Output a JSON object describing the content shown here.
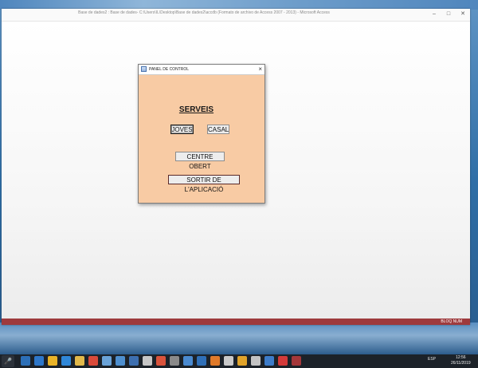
{
  "window": {
    "title": "Base de dades2 : Base de dades- C:\\Users\\IL\\Desktop\\Base de dades2\\accdb (Formato de archivo de Access 2007 - 2013) - Microsoft Access",
    "min_icon": "minimize-icon",
    "max_icon": "maximize-icon",
    "close_icon": "close-icon"
  },
  "form": {
    "title": "PANEL DE CONTROL",
    "close_label": "×",
    "heading": "SERVEIS",
    "buttons": {
      "joves": "JOVES",
      "casal": "CASAL",
      "centre": "CENTRE OBERT",
      "sortir": "SORTIR DE L'APLICACIÓ"
    }
  },
  "statusbar": {
    "text": "BLOQ NUM"
  },
  "taskbar": {
    "search_label": "🎤",
    "language": "ESP",
    "clock_time": "12:56",
    "clock_date": "26/11/2019",
    "apps": [
      {
        "name": "cortana-icon",
        "color": "#2c6fb7"
      },
      {
        "name": "mail-icon",
        "color": "#2e77c9"
      },
      {
        "name": "chrome-icon",
        "color": "#e8b227"
      },
      {
        "name": "edge-icon",
        "color": "#2f87d8"
      },
      {
        "name": "file-explorer-icon",
        "color": "#e1b84a"
      },
      {
        "name": "chrome-alt-icon",
        "color": "#d94a3a"
      },
      {
        "name": "app-icon-7",
        "color": "#6aa3d8"
      },
      {
        "name": "app-icon-8",
        "color": "#4e8fcf"
      },
      {
        "name": "app-icon-9",
        "color": "#3d6fb0"
      },
      {
        "name": "app-icon-10",
        "color": "#c6c6c6"
      },
      {
        "name": "app-icon-11",
        "color": "#d9533c"
      },
      {
        "name": "app-icon-12",
        "color": "#8a8a8a"
      },
      {
        "name": "app-icon-13",
        "color": "#4a8ad0"
      },
      {
        "name": "app-icon-14",
        "color": "#2f6fb7"
      },
      {
        "name": "app-icon-15",
        "color": "#e07a2a"
      },
      {
        "name": "app-icon-16",
        "color": "#c9c9c9"
      },
      {
        "name": "app-icon-17",
        "color": "#e0a32a"
      },
      {
        "name": "app-icon-18",
        "color": "#c3c3c3"
      },
      {
        "name": "app-icon-19",
        "color": "#3d7cc9"
      },
      {
        "name": "app-icon-20",
        "color": "#d33a3a"
      },
      {
        "name": "access-icon",
        "color": "#a4373a"
      }
    ]
  },
  "colors": {
    "form_background": "#f8cba4",
    "status_bar": "#9e3a3d",
    "taskbar": "#1c2229"
  }
}
